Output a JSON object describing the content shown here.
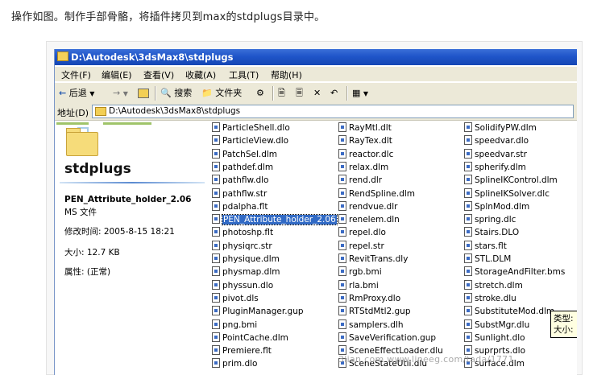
{
  "caption": "操作如图。制作手部骨骼，将插件拷贝到max的stdplugs目录中。",
  "window": {
    "title": "D:\\Autodesk\\3dsMax8\\stdplugs",
    "menu": [
      "文件(F)",
      "编辑(E)",
      "查看(V)",
      "收藏(A)",
      "工具(T)",
      "帮助(H)"
    ],
    "toolbar": {
      "back": "后退",
      "search": "搜索",
      "folders": "文件夹"
    },
    "address_label": "地址(D)",
    "address_value": "D:\\Autodesk\\3dsMax8\\stdplugs"
  },
  "details": {
    "folder_name": "stdplugs",
    "file_name": "PEN_Attribute_holder_2.06",
    "file_type": "MS 文件",
    "modified": "修改时间: 2005-8-15 18:21",
    "size": "大小: 12.7 KB",
    "attributes": "属性: (正常)"
  },
  "files": {
    "col1": [
      "ParticleShell.dlo",
      "ParticleView.dlo",
      "PatchSel.dlm",
      "pathdef.dlm",
      "pathflw.dlo",
      "pathflw.str",
      "pdalpha.flt",
      "PEN_Attribute_holder_2.06",
      "photoshp.flt",
      "physiqrc.str",
      "physique.dlm",
      "physmap.dlm",
      "physsun.dlo",
      "pivot.dls",
      "PluginManager.gup",
      "png.bmi",
      "PointCache.dlm",
      "Premiere.flt",
      "prim.dlo"
    ],
    "col2": [
      "RayMtl.dlt",
      "RayTex.dlt",
      "reactor.dlc",
      "relax.dlm",
      "rend.dlr",
      "RendSpline.dlm",
      "rendvue.dlr",
      "renelem.dln",
      "repel.dlo",
      "repel.str",
      "RevitTrans.dly",
      "rgb.bmi",
      "rla.bmi",
      "RmProxy.dlo",
      "RTStdMtl2.gup",
      "samplers.dlh",
      "SaveVerification.gup",
      "SceneEffectLoader.dlu",
      "SceneStateUtil.dlu"
    ],
    "col3": [
      "SolidifyPW.dlm",
      "speedvar.dlo",
      "speedvar.str",
      "spherify.dlm",
      "SplineIKControl.dlm",
      "SplineIKSolver.dlc",
      "SplnMod.dlm",
      "spring.dlc",
      "Stairs.DLO",
      "stars.flt",
      "STL.DLM",
      "StorageAndFilter.bms",
      "stretch.dlm",
      "stroke.dlu",
      "SubstituteMod.dlm",
      "SubstMgr.dlu",
      "Sunlight.dlo",
      "suprprts.dlo",
      "surface.dlm"
    ],
    "selected": "PEN_Attribute_holder_2.06"
  },
  "tooltip": {
    "line1": "类型:",
    "line2": "大小:"
  },
  "watermark": "3lian.com  www.lineeg.com/tada/1771"
}
